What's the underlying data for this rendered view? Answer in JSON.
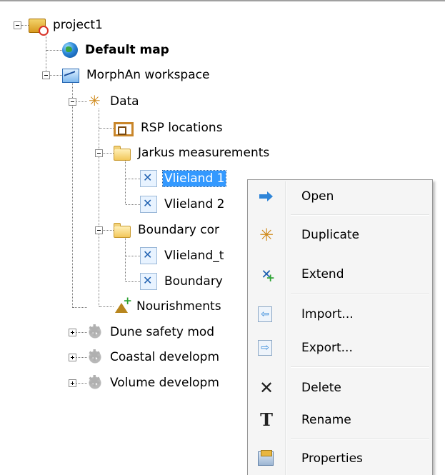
{
  "tree": {
    "items": [
      {
        "label": "project1",
        "icon": "project-icon"
      },
      {
        "label": "Default map",
        "icon": "globe-icon"
      },
      {
        "label": "MorphAn workspace",
        "icon": "workspace-icon"
      },
      {
        "label": "Data",
        "icon": "data-icon"
      },
      {
        "label": "RSP locations",
        "icon": "rsp-icon"
      },
      {
        "label": "Jarkus measurements",
        "icon": "folder-icon"
      },
      {
        "label": "Vlieland 1",
        "icon": "transect-icon",
        "selected": true
      },
      {
        "label": "Vlieland 2",
        "icon": "transect-icon"
      },
      {
        "label": "Boundary cor",
        "icon": "folder-icon"
      },
      {
        "label": "Vlieland_t",
        "icon": "transect-gray-icon"
      },
      {
        "label": "Boundary",
        "icon": "transect-gray-icon"
      },
      {
        "label": "Nourishments",
        "icon": "nourishment-icon"
      },
      {
        "label": "Dune safety mod",
        "icon": "gear-icon"
      },
      {
        "label": "Coastal developm",
        "icon": "gear-icon"
      },
      {
        "label": "Volume developm",
        "icon": "gear-icon"
      }
    ]
  },
  "context_menu": {
    "items": [
      {
        "label": "Open",
        "icon": "open-arrow-icon"
      },
      {
        "label": "Duplicate",
        "icon": "duplicate-icon"
      },
      {
        "label": "Extend",
        "icon": "extend-icon"
      },
      {
        "label": "Import...",
        "icon": "import-icon"
      },
      {
        "label": "Export...",
        "icon": "export-icon"
      },
      {
        "label": "Delete",
        "icon": "delete-icon"
      },
      {
        "label": "Rename",
        "icon": "rename-icon"
      },
      {
        "label": "Properties",
        "icon": "properties-icon"
      }
    ]
  },
  "colors": {
    "selection": "#3399ff",
    "menu_background": "#f5f5f5",
    "folder": "#f2c75a"
  }
}
